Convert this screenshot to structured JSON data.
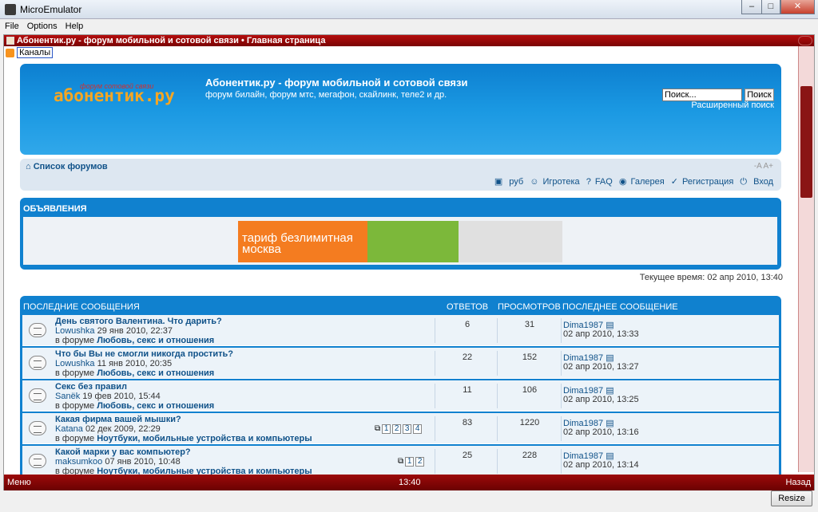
{
  "window": {
    "title": "MicroEmulator"
  },
  "menu": [
    "File",
    "Options",
    "Help"
  ],
  "page_title": "Абонентик.ру - форум мобильной и сотовой связи • Главная страница",
  "channels": "Каналы",
  "header": {
    "logo": "абонентик.ру",
    "logo_sub": "форум сотовой связи",
    "title": "Абонентик.ру - форум мобильной и сотовой связи",
    "desc": "форум билайн, форум мтс, мегафон, скайлинк, теле2 и др.",
    "search_placeholder": "Поиск...",
    "search_btn": "Поиск",
    "adv_search": "Расширенный поиск"
  },
  "nav": {
    "home": "Список форумов",
    "fontsize": "-A A+",
    "links": [
      "руб",
      "Игротека",
      "FAQ",
      "Галерея",
      "Регистрация",
      "Вход"
    ]
  },
  "announcements": {
    "heading": "ОБЪЯВЛЕНИЯ",
    "banner": "тариф безлимитная москва"
  },
  "time": "Текущее время: 02 апр 2010, 13:40",
  "topics": {
    "headers": {
      "title": "ПОСЛЕДНИЕ СООБЩЕНИЯ",
      "replies": "ОТВЕТОВ",
      "views": "ПРОСМОТРОВ",
      "last": "ПОСЛЕДНЕЕ СООБЩЕНИЕ"
    },
    "rows": [
      {
        "title": "День святого Валентина. Что дарить?",
        "author": "Lowushka",
        "date": "29 янв 2010, 22:37",
        "forum_pre": "в форуме",
        "forum": "Любовь, секс и отношения",
        "replies": "6",
        "views": "31",
        "last_user": "Dima1987",
        "last_date": "02 апр 2010, 13:33"
      },
      {
        "title": "Что бы Вы не смогли никогда простить?",
        "author": "Lowushka",
        "date": "11 янв 2010, 20:35",
        "forum_pre": "в форуме",
        "forum": "Любовь, секс и отношения",
        "replies": "22",
        "views": "152",
        "last_user": "Dima1987",
        "last_date": "02 апр 2010, 13:27"
      },
      {
        "title": "Секс без правил",
        "author": "Sanёk",
        "date": "19 фев 2010, 15:44",
        "forum_pre": "в форуме",
        "forum": "Любовь, секс и отношения",
        "replies": "11",
        "views": "106",
        "last_user": "Dima1987",
        "last_date": "02 апр 2010, 13:25"
      },
      {
        "title": "Какая фирма вашей мышки?",
        "author": "Katana",
        "date": "02 дек 2009, 22:29",
        "forum_pre": "в форуме",
        "forum": "Ноутбуки, мобильные устройства и компьютеры",
        "replies": "83",
        "views": "1220",
        "last_user": "Dima1987",
        "last_date": "02 апр 2010, 13:16",
        "pages": [
          "1",
          "2",
          "3",
          "4"
        ]
      },
      {
        "title": "Какой марки у вас компьютер?",
        "author": "maksumkoo",
        "date": "07 янв 2010, 10:48",
        "forum_pre": "в форуме",
        "forum": "Ноутбуки, мобильные устройства и компьютеры",
        "replies": "25",
        "views": "228",
        "last_user": "Dima1987",
        "last_date": "02 апр 2010, 13:14",
        "pages": [
          "1",
          "2"
        ]
      }
    ]
  },
  "softkeys": {
    "left": "Меню",
    "clock": "13:40",
    "right": "Назад"
  },
  "resize": "Resize"
}
